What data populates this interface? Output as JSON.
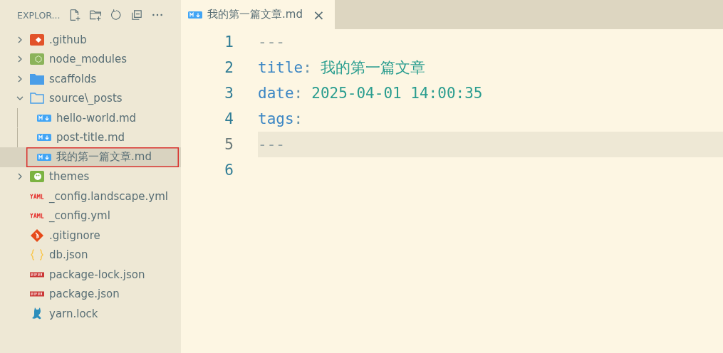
{
  "sidebar": {
    "title": "EXPLOR...",
    "tree": [
      {
        "name": ".github",
        "kind": "github",
        "expanded": false,
        "selected": false
      },
      {
        "name": "node_modules",
        "kind": "node",
        "expanded": false,
        "selected": false
      },
      {
        "name": "scaffolds",
        "kind": "folder",
        "expanded": false,
        "selected": false
      },
      {
        "name": "source\\_posts",
        "kind": "folder",
        "expanded": true,
        "selected": false,
        "children": [
          {
            "name": "hello-world.md",
            "kind": "markdown",
            "selected": false
          },
          {
            "name": "post-title.md",
            "kind": "markdown",
            "selected": false
          },
          {
            "name": "我的第一篇文章.md",
            "kind": "markdown",
            "selected": true
          }
        ]
      },
      {
        "name": "themes",
        "kind": "palette",
        "expanded": false,
        "selected": false
      },
      {
        "name": "_config.landscape.yml",
        "kind": "yaml",
        "selected": false
      },
      {
        "name": "_config.yml",
        "kind": "yaml",
        "selected": false
      },
      {
        "name": ".gitignore",
        "kind": "git",
        "selected": false
      },
      {
        "name": "db.json",
        "kind": "json",
        "selected": false
      },
      {
        "name": "package-lock.json",
        "kind": "npm",
        "selected": false
      },
      {
        "name": "package.json",
        "kind": "npm",
        "selected": false
      },
      {
        "name": "yarn.lock",
        "kind": "yarn",
        "selected": false
      }
    ]
  },
  "tabs": [
    {
      "label": "我的第一篇文章.md",
      "kind": "markdown",
      "selected": true,
      "close": "×"
    }
  ],
  "editor": {
    "lines": [
      {
        "number": "1",
        "current": false,
        "tokens": [
          {
            "kind": "punct",
            "text": "---"
          }
        ]
      },
      {
        "number": "2",
        "current": false,
        "tokens": [
          {
            "kind": "key",
            "text": "title"
          },
          {
            "kind": "colon",
            "text": ":"
          },
          {
            "kind": "value",
            "text": "我的第一篇文章"
          }
        ]
      },
      {
        "number": "3",
        "current": false,
        "tokens": [
          {
            "kind": "key",
            "text": "date"
          },
          {
            "kind": "colon",
            "text": ":"
          },
          {
            "kind": "value",
            "text": "2025-04-01 14:00:35"
          }
        ]
      },
      {
        "number": "4",
        "current": false,
        "tokens": [
          {
            "kind": "key",
            "text": "tags"
          },
          {
            "kind": "colon",
            "text": ":"
          }
        ]
      },
      {
        "number": "5",
        "current": true,
        "tokens": [
          {
            "kind": "punct",
            "text": "---"
          }
        ]
      },
      {
        "number": "6",
        "current": false
      }
    ]
  }
}
